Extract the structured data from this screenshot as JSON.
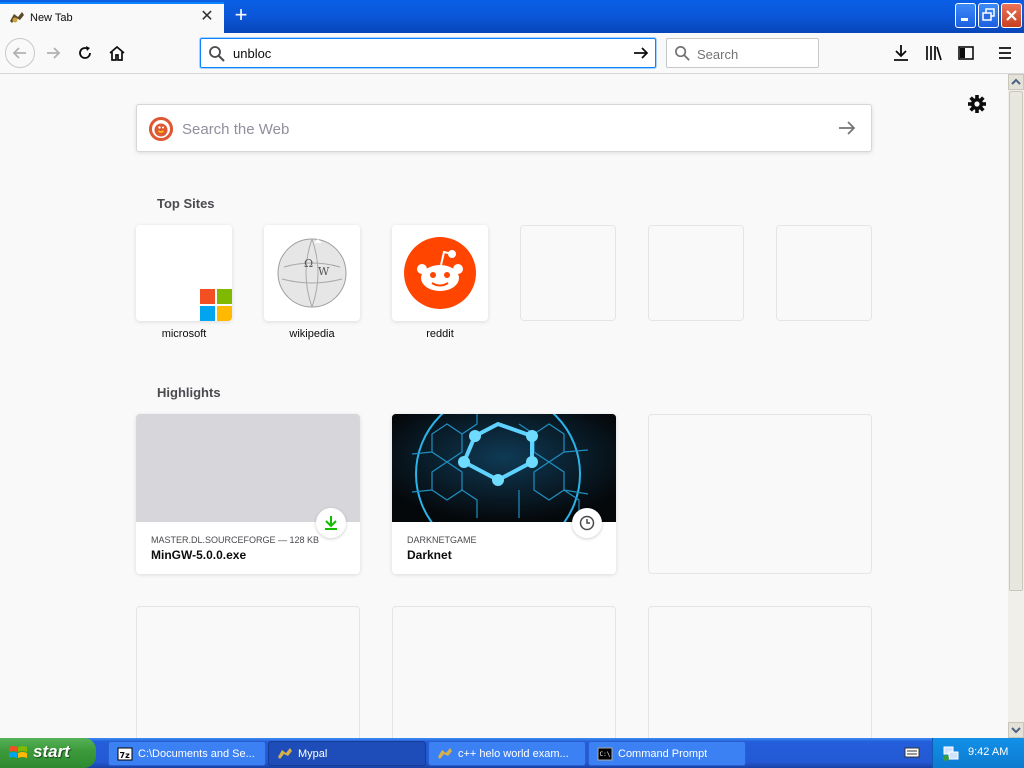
{
  "tab": {
    "title": "New Tab",
    "close_glyph": "✕",
    "new_glyph": "+"
  },
  "nav": {
    "url_value": "unbloc",
    "search_placeholder": "Search"
  },
  "newtab": {
    "web_search_placeholder": "Search the Web",
    "top_sites_title": "Top Sites",
    "highlights_title": "Highlights",
    "top_sites": [
      {
        "label": "microsoft",
        "icon": "microsoft-logo"
      },
      {
        "label": "wikipedia",
        "icon": "wikipedia-globe"
      },
      {
        "label": "reddit",
        "icon": "reddit-logo"
      },
      {
        "label": "",
        "icon": ""
      },
      {
        "label": "",
        "icon": ""
      },
      {
        "label": "",
        "icon": ""
      }
    ],
    "highlights": [
      {
        "source": "MASTER.DL.SOURCEFORGE — 128 KB",
        "title": "MinGW-5.0.0.exe",
        "badge": "download-icon"
      },
      {
        "source": "DARKNETGAME",
        "title": "Darknet",
        "badge": "history-icon"
      }
    ]
  },
  "taskbar": {
    "start_label": "start",
    "tasks": [
      {
        "label": "C:\\Documents and Se...",
        "icon": "7zip-icon"
      },
      {
        "label": "Mypal",
        "icon": "mypal-icon"
      },
      {
        "label": "c++ helo world exam...",
        "icon": "mypal-icon"
      },
      {
        "label": "Command Prompt",
        "icon": "cmd-icon"
      }
    ],
    "clock": "9:42 AM"
  },
  "colors": {
    "accent": "#0a84ff",
    "reddit": "#ff4500",
    "download_green": "#12bc00",
    "xp_blue": "#245edb",
    "xp_green": "#3c9b3c"
  }
}
